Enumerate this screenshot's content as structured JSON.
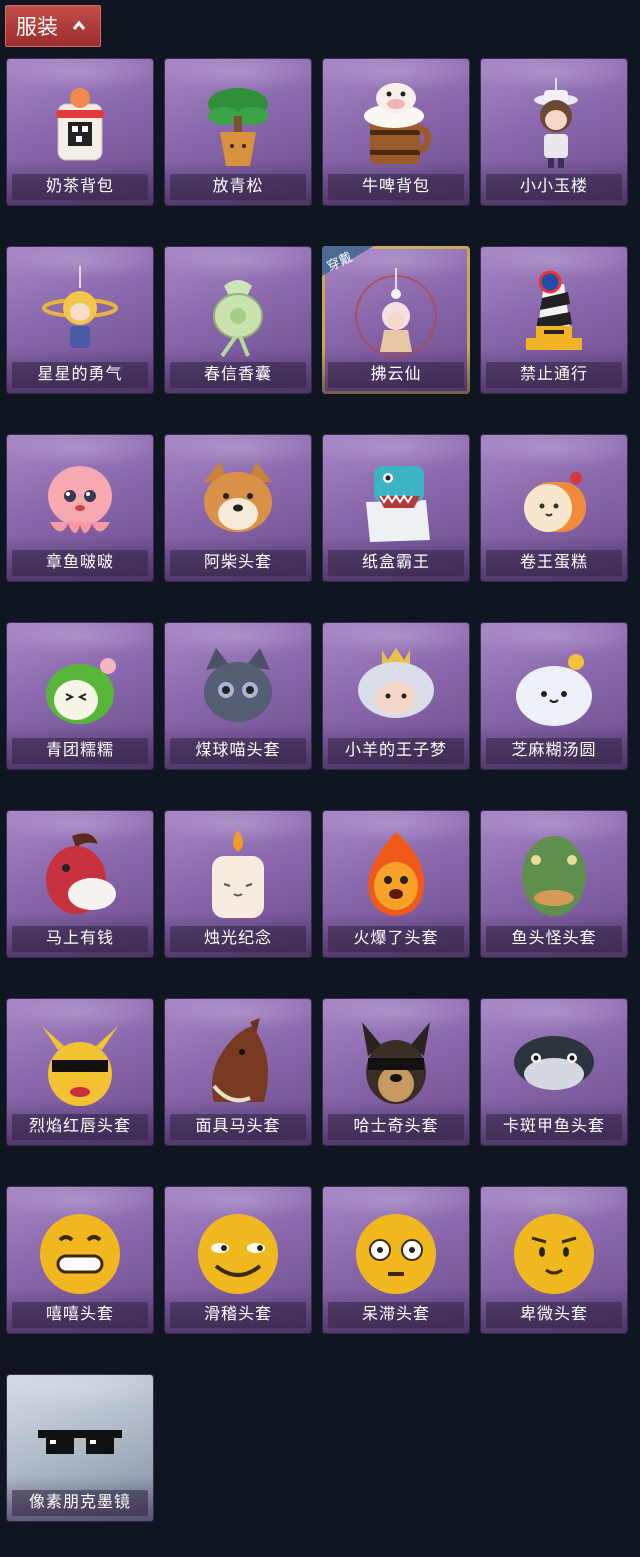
{
  "header": {
    "title": "服装"
  },
  "equipped_badge": "穿戴",
  "items": [
    {
      "label": "奶茶背包"
    },
    {
      "label": "放青松"
    },
    {
      "label": "牛啤背包"
    },
    {
      "label": "小小玉楼"
    },
    {
      "label": "星星的勇气"
    },
    {
      "label": "春信香囊"
    },
    {
      "label": "拂云仙"
    },
    {
      "label": "禁止通行"
    },
    {
      "label": "章鱼啵啵"
    },
    {
      "label": "阿柴头套"
    },
    {
      "label": "纸盒霸王"
    },
    {
      "label": "卷王蛋糕"
    },
    {
      "label": "青团糯糯"
    },
    {
      "label": "煤球喵头套"
    },
    {
      "label": "小羊的王子梦"
    },
    {
      "label": "芝麻糊汤圆"
    },
    {
      "label": "马上有钱"
    },
    {
      "label": "烛光纪念"
    },
    {
      "label": "火爆了头套"
    },
    {
      "label": "鱼头怪头套"
    },
    {
      "label": "烈焰红唇头套"
    },
    {
      "label": "面具马头套"
    },
    {
      "label": "哈士奇头套"
    },
    {
      "label": "卡斑甲鱼头套"
    },
    {
      "label": "嘻嘻头套"
    },
    {
      "label": "滑稽头套"
    },
    {
      "label": "呆滞头套"
    },
    {
      "label": "卑微头套"
    },
    {
      "label": "像素朋克墨镜"
    }
  ]
}
